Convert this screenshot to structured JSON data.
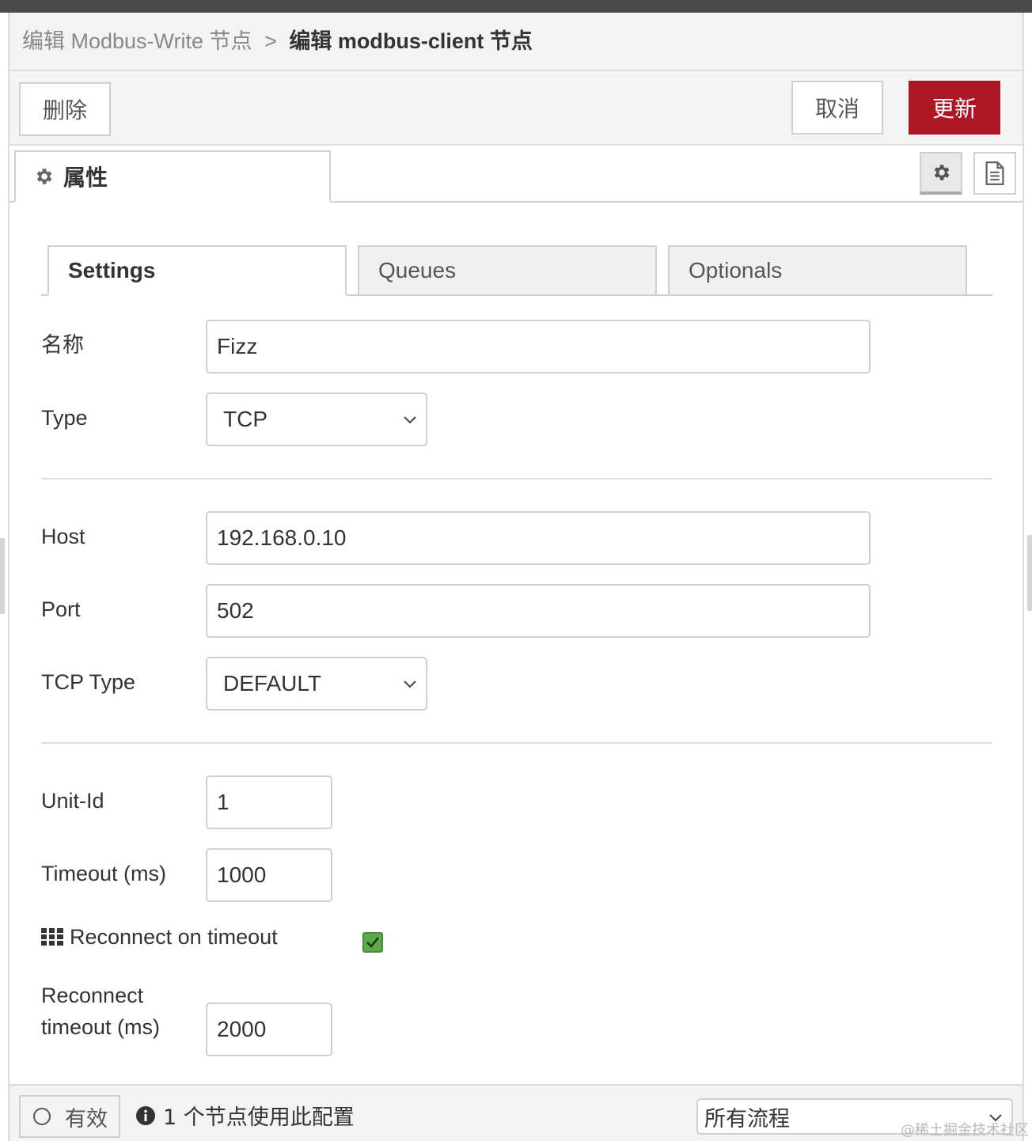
{
  "header": {
    "breadcrumb_prev": "编辑 Modbus-Write 节点",
    "breadcrumb_sep": ">",
    "breadcrumb_current": "编辑 modbus-client 节点"
  },
  "toolbar": {
    "delete_label": "删除",
    "cancel_label": "取消",
    "update_label": "更新"
  },
  "tabs": {
    "properties_label": "属性"
  },
  "subtabs": [
    {
      "label": "Settings"
    },
    {
      "label": "Queues"
    },
    {
      "label": "Optionals"
    }
  ],
  "form": {
    "name": {
      "label": "名称",
      "value": "Fizz"
    },
    "type": {
      "label": "Type",
      "value": "TCP"
    },
    "host": {
      "label": "Host",
      "value": "192.168.0.10"
    },
    "port": {
      "label": "Port",
      "value": "502"
    },
    "tcp_type": {
      "label": "TCP Type",
      "value": "DEFAULT"
    },
    "unit_id": {
      "label": "Unit-Id",
      "value": "1"
    },
    "timeout": {
      "label": "Timeout (ms)",
      "value": "1000"
    },
    "reconnect_on_timeout": {
      "label": "Reconnect on timeout",
      "checked": true
    },
    "reconnect_timeout": {
      "label_line1": "Reconnect",
      "label_line2": "timeout (ms)",
      "value": "2000"
    }
  },
  "footer": {
    "valid_label": "有效",
    "usage_text": "1 个节点使用此配置",
    "flow_scope": "所有流程"
  },
  "watermark": "@稀土掘金技术社区",
  "colors": {
    "update_button": "#ad1625",
    "checkbox": "#5fa84a",
    "topbar": "#4a4a4a"
  },
  "icons": [
    "gear-icon",
    "document-icon",
    "chevron-down-icon",
    "grid-icon",
    "check-icon",
    "info-icon",
    "circle-icon"
  ]
}
